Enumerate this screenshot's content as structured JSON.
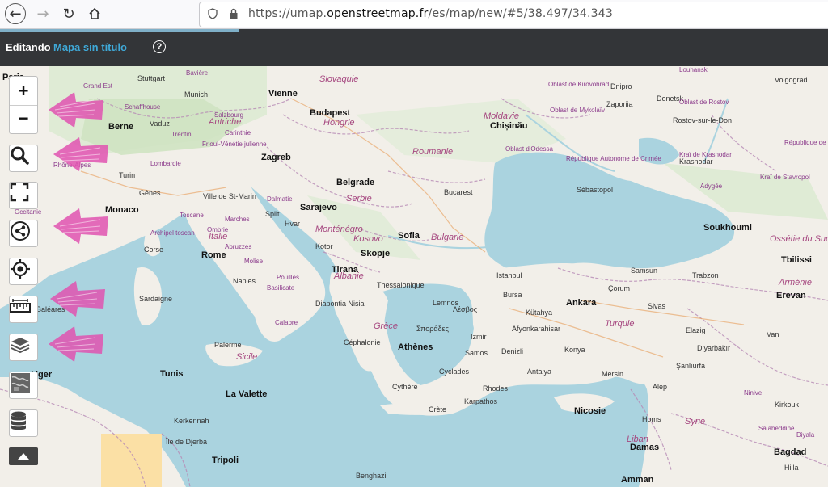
{
  "browser": {
    "url_prefix": "https://umap.",
    "url_domain": "openstreetmap.fr",
    "url_path": "/es/map/new/#5/38.497/34.343"
  },
  "header": {
    "edit_label": "Editando",
    "map_title": "Mapa sin título",
    "help": "?"
  },
  "controls": {
    "zoom_in": "+",
    "zoom_out": "−",
    "icons": [
      "search-icon",
      "fullscreen-icon",
      "share-icon",
      "locate-icon",
      "measure-icon",
      "layers-icon",
      "map-preview-icon",
      "data-icon"
    ]
  },
  "map": {
    "cities": [
      "Paris",
      "Grand Est",
      "Stuttgart",
      "Bavière",
      "Munich",
      "Vienne",
      "Slovaquie",
      "Budapest",
      "Hongrie",
      "Schaffhouse",
      "Berne",
      "Vaduz",
      "Salzbourg",
      "Autriche",
      "Carinthie",
      "Zagreb",
      "Belgrade",
      "Serbie",
      "Bucarest",
      "Roumanie",
      "Moldavie",
      "Chișinău",
      "Oblast de Kirovohrad",
      "Oblast de Mykolaïv",
      "Oblast d'Odessa",
      "Dnipro",
      "Zaporiia",
      "Donetsk",
      "Oblast de Rostov",
      "Rostov-sur-le-Don",
      "Volgograd",
      "Louhansk",
      "Sarajevo",
      "Monténégro",
      "Kosovo",
      "Sofia",
      "Bulgarie",
      "Skopje",
      "Tirana",
      "Albanie",
      "Thessalonique",
      "Monaco",
      "Gênes",
      "Turin",
      "Ville de St-Marin",
      "Italie",
      "Rome",
      "Naples",
      "Corse",
      "Archipel toscan",
      "Abruzzes",
      "Molise",
      "Pouilles",
      "Basilicate",
      "Calabre",
      "Sardaigne",
      "Palerme",
      "Sicile",
      "Istanbul",
      "Bursa",
      "Kütahya",
      "Afyonkarahisar",
      "Izmir",
      "Samos",
      "Denizli",
      "Konya",
      "Antalya",
      "Mersin",
      "Ankara",
      "Çorum",
      "Samsun",
      "Trabzon",
      "Sivas",
      "Turquie",
      "Elazig",
      "Van",
      "Diyarbakır",
      "Şanlıurfa",
      "Alep",
      "Erevan",
      "Arménie",
      "Tbilissi",
      "Ossétie du Sud",
      "Soukhoumi",
      "Krasnodar",
      "Kraï de Krasnodar",
      "Kraï de Stavropol",
      "République de Kalmoukie",
      "Adygée",
      "Sébastopol",
      "République Autonome de Crimée",
      "Grèce",
      "Athènes",
      "Lemnos",
      "Σποράδες",
      "Céphalonie",
      "Cyclades",
      "Rhodes",
      "Karpathos",
      "Crète",
      "Nicosie",
      "Tunis",
      "Alger",
      "La Valette",
      "Kerkennah",
      "Île de Djerba",
      "Tripoli",
      "Benghazi",
      "Liban",
      "Homs",
      "Damas",
      "Syrie",
      "Ninive",
      "Kirkouk",
      "Salaheddine",
      "Diyala",
      "Bagdad",
      "Hilla",
      "Amman",
      "Rhône-Alpes",
      "Occitanie",
      "Lombardie",
      "Frioul-Vénétie julienne",
      "Trentin",
      "Marches",
      "Ombrie",
      "Toscane",
      "Dalmatie",
      "Baléares",
      "Hvar",
      "Split",
      "Kotor",
      "Diapontia Nisia",
      "Cythère",
      "Λέσβος"
    ]
  }
}
